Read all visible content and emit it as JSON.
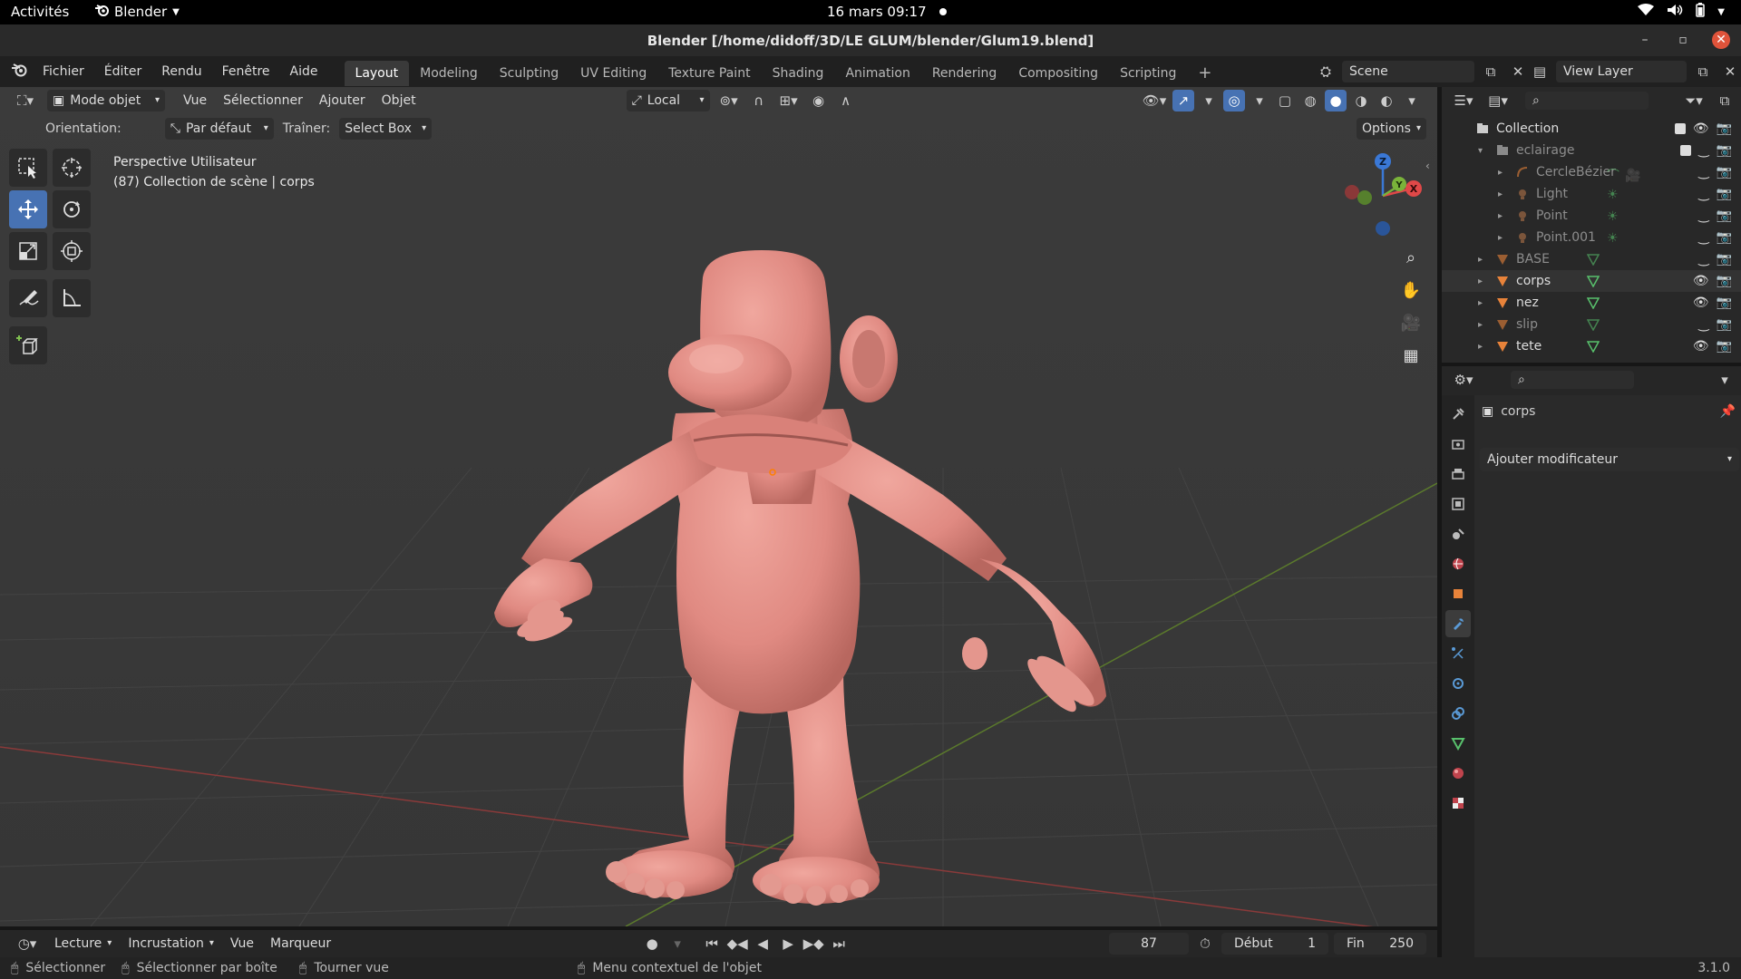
{
  "gnome": {
    "activities": "Activités",
    "app_name": "Blender",
    "clock": "16 mars  09:17"
  },
  "window": {
    "title": "Blender [/home/didoff/3D/LE GLUM/blender/Glum19.blend]"
  },
  "menus": [
    "Fichier",
    "Éditer",
    "Rendu",
    "Fenêtre",
    "Aide"
  ],
  "workspaces": [
    "Layout",
    "Modeling",
    "Sculpting",
    "UV Editing",
    "Texture Paint",
    "Shading",
    "Animation",
    "Rendering",
    "Compositing",
    "Scripting"
  ],
  "active_workspace": "Layout",
  "scene_name": "Scene",
  "view_layer": "View Layer",
  "viewport_header": {
    "mode": "Mode objet",
    "menus": [
      "Vue",
      "Sélectionner",
      "Ajouter",
      "Objet"
    ],
    "transform_space": "Local"
  },
  "tool_header": {
    "orientation_label": "Orientation:",
    "orientation_value": "Par défaut",
    "drag_label": "Traîner:",
    "drag_value": "Select Box",
    "options": "Options"
  },
  "viewport_info": {
    "line1": "Perspective Utilisateur",
    "line2": "(87) Collection de scène | corps"
  },
  "gizmo_axes": {
    "z": "Z",
    "y": "Y",
    "x": "X"
  },
  "outliner": {
    "items": [
      {
        "label": "Collection",
        "depth": 0,
        "type": "collection"
      },
      {
        "label": "eclairage",
        "depth": 1,
        "type": "collection",
        "dim": true
      },
      {
        "label": "CercleBézier",
        "depth": 2,
        "type": "curve",
        "dim": true
      },
      {
        "label": "Light",
        "depth": 2,
        "type": "light",
        "dim": true
      },
      {
        "label": "Point",
        "depth": 2,
        "type": "light",
        "dim": true
      },
      {
        "label": "Point.001",
        "depth": 2,
        "type": "light",
        "dim": true
      },
      {
        "label": "BASE",
        "depth": 1,
        "type": "mesh",
        "dim": true
      },
      {
        "label": "corps",
        "depth": 1,
        "type": "mesh",
        "active": true
      },
      {
        "label": "nez",
        "depth": 1,
        "type": "mesh"
      },
      {
        "label": "slip",
        "depth": 1,
        "type": "mesh",
        "dim": true
      },
      {
        "label": "tete",
        "depth": 1,
        "type": "mesh"
      }
    ]
  },
  "properties": {
    "object_name": "corps",
    "add_modifier": "Ajouter modificateur"
  },
  "timeline": {
    "menus": [
      "Lecture",
      "Incrustation",
      "Vue",
      "Marqueur"
    ],
    "current_frame": "87",
    "start_label": "Début",
    "start_value": "1",
    "end_label": "Fin",
    "end_value": "250"
  },
  "status": {
    "select": "Sélectionner",
    "box_select": "Sélectionner par boîte",
    "rotate_view": "Tourner vue",
    "context_menu": "Menu contextuel de l'objet",
    "version": "3.1.0"
  },
  "colors": {
    "accent": "#4772b3",
    "character_skin": "#e08a82",
    "x_axis": "#e04848",
    "y_axis": "#7ab33a",
    "z_axis": "#3a78d6",
    "origin": "#ff7f00"
  }
}
